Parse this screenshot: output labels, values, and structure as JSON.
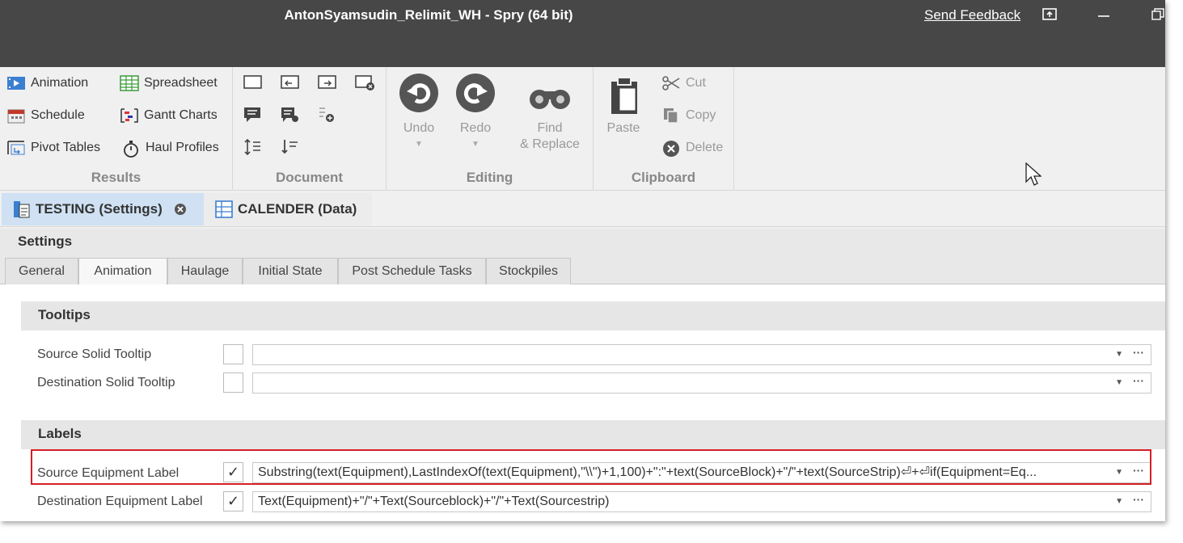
{
  "window": {
    "title": "AntonSyamsudin_Relimit_WH - Spry (64 bit)",
    "feedback": "Send Feedback",
    "buttons": [
      "restore-ribbon-icon",
      "minimize-icon",
      "maximize-icon"
    ]
  },
  "ribbon": {
    "results": {
      "label": "Results",
      "items": [
        "Animation",
        "Spreadsheet",
        "Schedule",
        "Gantt Charts",
        "Pivot Tables",
        "Haul Profiles"
      ]
    },
    "document": {
      "label": "Document"
    },
    "editing": {
      "label": "Editing",
      "undo": "Undo",
      "redo": "Redo",
      "find_line1": "Find",
      "find_line2": "& Replace"
    },
    "clipboard": {
      "label": "Clipboard",
      "paste": "Paste",
      "cut": "Cut",
      "copy": "Copy",
      "delete": "Delete"
    }
  },
  "doc_tabs": [
    {
      "label": "TESTING (Settings)",
      "active": true
    },
    {
      "label": "CALENDER (Data)",
      "active": false
    }
  ],
  "settings": {
    "header": "Settings",
    "tabs": [
      "General",
      "Animation",
      "Haulage",
      "Initial State",
      "Post Schedule Tasks",
      "Stockpiles"
    ],
    "active_tab": "Animation",
    "tooltips": {
      "header": "Tooltips",
      "rows": [
        {
          "label": "Source Solid Tooltip",
          "checked": false,
          "value": ""
        },
        {
          "label": "Destination Solid Tooltip",
          "checked": false,
          "value": ""
        }
      ]
    },
    "labels": {
      "header": "Labels",
      "rows": [
        {
          "label": "Source Equipment Label",
          "checked": true,
          "value": "Substring(text(Equipment),LastIndexOf(text(Equipment),\"\\\\\")+1,100)+\":\"+text(SourceBlock)+\"/\"+text(SourceStrip)⏎+⏎if(Equipment=Eq..."
        },
        {
          "label": "Destination Equipment Label",
          "checked": true,
          "value": "Text(Equipment)+\"/\"+Text(Sourceblock)+\"/\"+Text(Sourcestrip)"
        }
      ]
    }
  },
  "colors": {
    "titlebar": "#474747",
    "active_tab": "#cfe1f3",
    "highlight": "#d61f26"
  }
}
